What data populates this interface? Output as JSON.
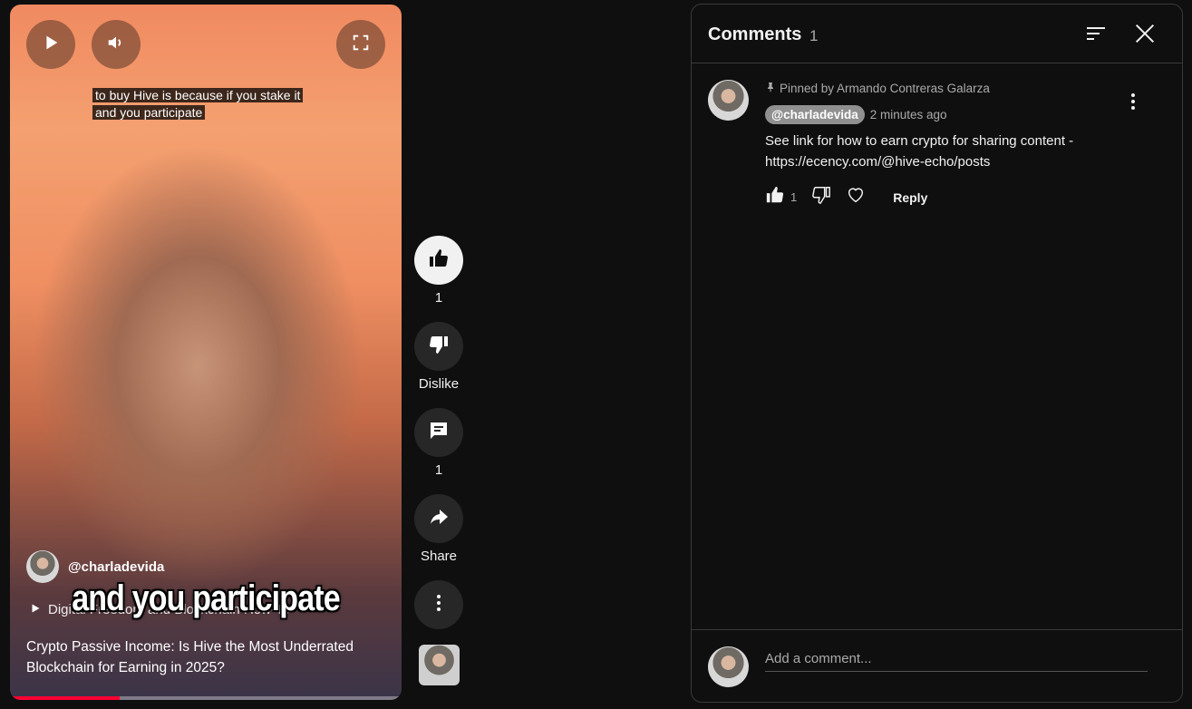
{
  "video": {
    "caption_top_line1": "to buy Hive is because if you stake it",
    "caption_top_line2": "and you participate",
    "caption_big": "and you participate",
    "channel_handle": "@charladevida",
    "playlist_label": "Digital Freedom and Blockchain How-To",
    "title": "Crypto Passive Income: Is Hive the Most Underrated Blockchain for Earning in 2025?",
    "progress_fraction": 0.28,
    "progress_color": "#ff0033"
  },
  "actions": {
    "like_count": "1",
    "dislike_label": "Dislike",
    "comment_count": "1",
    "share_label": "Share"
  },
  "comments_panel": {
    "title": "Comments",
    "count": "1",
    "comment": {
      "pinned_text": "Pinned by Armando Contreras Galarza",
      "author": "@charladevida",
      "time": "2 minutes ago",
      "text_line1": "See link for how to earn crypto for sharing content -",
      "text_line2": "https://ecency.com/@hive-echo/posts",
      "like_count": "1",
      "reply_label": "Reply"
    },
    "add_comment_placeholder": "Add a comment..."
  },
  "icons": {
    "play": "play-icon",
    "volume": "volume-icon",
    "fullscreen": "fullscreen-icon",
    "like": "thumbs-up-icon",
    "dislike": "thumbs-down-icon",
    "comment": "comment-icon",
    "share": "share-icon",
    "more": "more-vertical-icon",
    "sort": "sort-icon",
    "close": "close-icon",
    "pin": "pin-icon",
    "heart": "heart-icon"
  }
}
